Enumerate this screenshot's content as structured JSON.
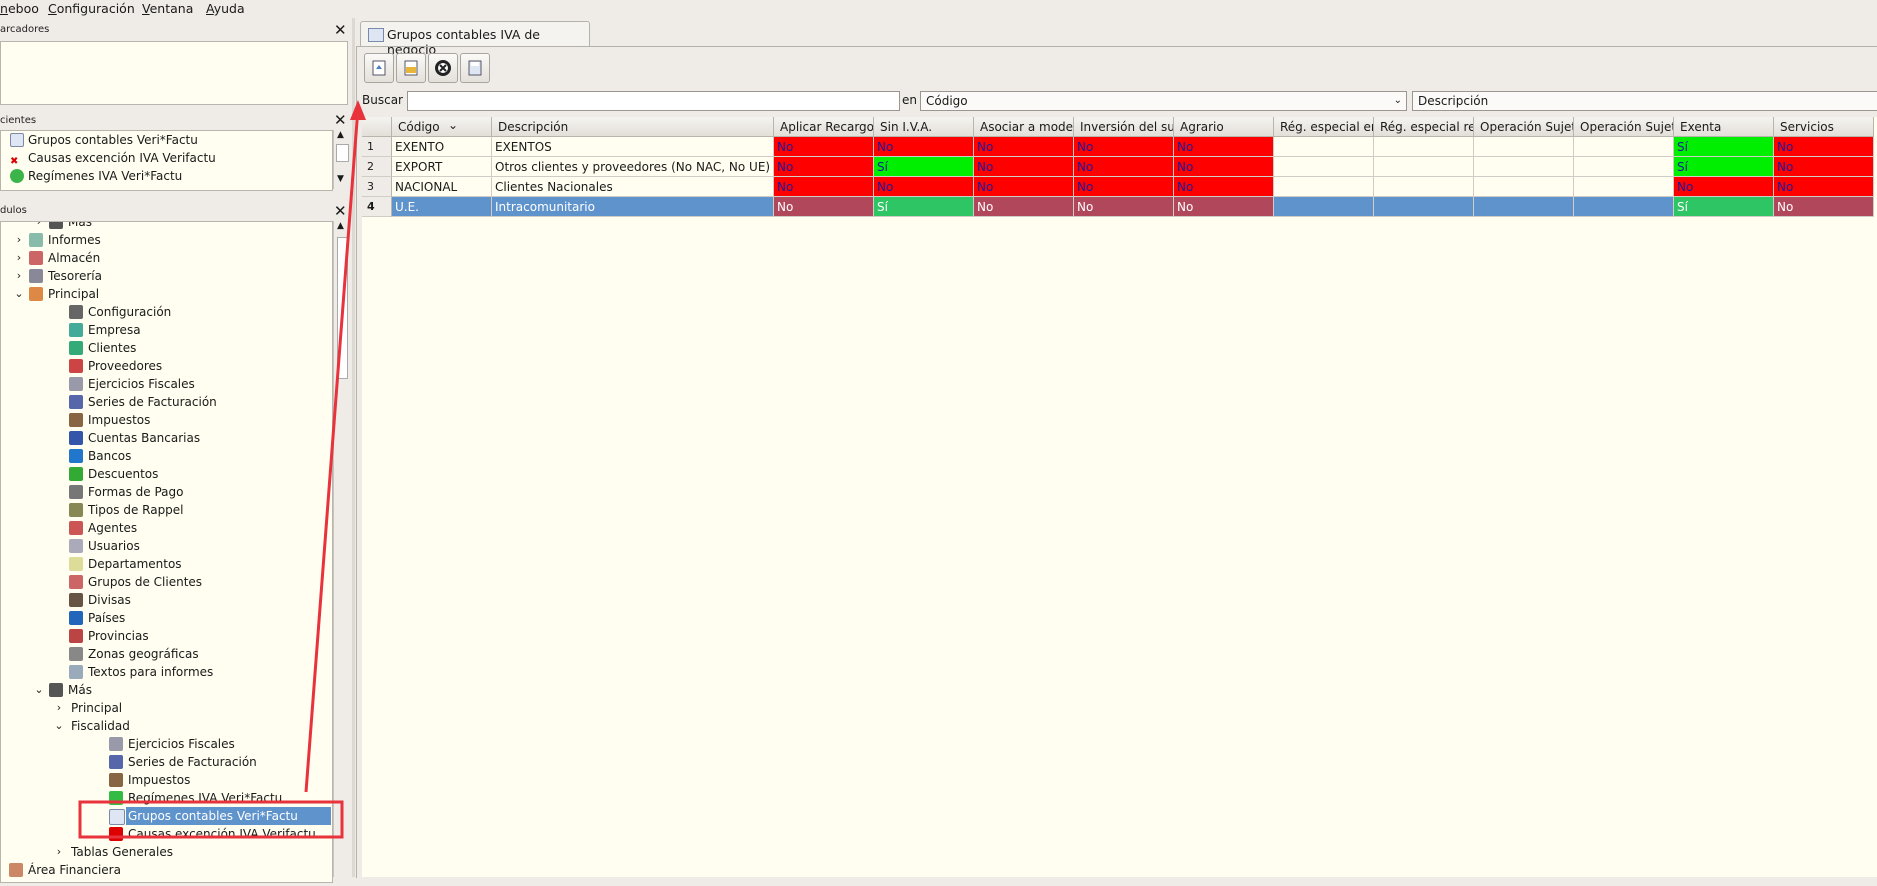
{
  "menu": [
    "neboo",
    "Configuración",
    "Ventana",
    "Ayuda"
  ],
  "panels": {
    "marcadores": "arcadores",
    "recientes": "cientes",
    "modulos": "dulos"
  },
  "recent": [
    "Grupos contables Veri*Factu",
    "Causas excención IVA Verifactu",
    "Regímenes IVA Veri*Factu"
  ],
  "tree": [
    {
      "label": "Más",
      "indent": 2,
      "expander": "›",
      "icon": "plus-icon"
    },
    {
      "label": "Informes",
      "indent": 1,
      "expander": "›",
      "icon": "reports-icon"
    },
    {
      "label": "Almacén",
      "indent": 1,
      "expander": "›",
      "icon": "warehouse-icon"
    },
    {
      "label": "Tesorería",
      "indent": 1,
      "expander": "›",
      "icon": "treasury-icon"
    },
    {
      "label": "Principal",
      "indent": 1,
      "expander": "⌄",
      "icon": "main-icon"
    },
    {
      "label": "Configuración",
      "indent": 3,
      "icon": "wrench-icon"
    },
    {
      "label": "Empresa",
      "indent": 3,
      "icon": "company-icon"
    },
    {
      "label": "Clientes",
      "indent": 3,
      "icon": "clients-icon"
    },
    {
      "label": "Proveedores",
      "indent": 3,
      "icon": "suppliers-icon"
    },
    {
      "label": "Ejercicios Fiscales",
      "indent": 3,
      "icon": "calendar-icon"
    },
    {
      "label": "Series de Facturación",
      "indent": 3,
      "icon": "series-icon"
    },
    {
      "label": "Impuestos",
      "indent": 3,
      "icon": "taxes-icon"
    },
    {
      "label": "Cuentas Bancarias",
      "indent": 3,
      "icon": "bank-account-icon"
    },
    {
      "label": "Bancos",
      "indent": 3,
      "icon": "bank-icon"
    },
    {
      "label": "Descuentos",
      "indent": 3,
      "icon": "discount-icon"
    },
    {
      "label": "Formas de Pago",
      "indent": 3,
      "icon": "payment-icon"
    },
    {
      "label": "Tipos de Rappel",
      "indent": 3,
      "icon": "rappel-icon"
    },
    {
      "label": "Agentes",
      "indent": 3,
      "icon": "agents-icon"
    },
    {
      "label": "Usuarios",
      "indent": 3,
      "icon": "users-icon"
    },
    {
      "label": "Departamentos",
      "indent": 3,
      "icon": "departments-icon"
    },
    {
      "label": "Grupos de Clientes",
      "indent": 3,
      "icon": "client-groups-icon"
    },
    {
      "label": "Divisas",
      "indent": 3,
      "icon": "currency-icon"
    },
    {
      "label": "Países",
      "indent": 3,
      "icon": "globe-icon"
    },
    {
      "label": "Provincias",
      "indent": 3,
      "icon": "provinces-icon"
    },
    {
      "label": "Zonas geográficas",
      "indent": 3,
      "icon": "zones-icon"
    },
    {
      "label": "Textos para informes",
      "indent": 3,
      "icon": "texts-icon"
    },
    {
      "label": "Más",
      "indent": 2,
      "expander": "⌄",
      "icon": "plus-icon"
    },
    {
      "label": "Principal",
      "indent": 3,
      "expander": "›"
    },
    {
      "label": "Fiscalidad",
      "indent": 3,
      "expander": "⌄"
    },
    {
      "label": "Ejercicios Fiscales",
      "indent": 5,
      "icon": "calendar-icon"
    },
    {
      "label": "Series de Facturación",
      "indent": 5,
      "icon": "series-icon"
    },
    {
      "label": "Impuestos",
      "indent": 5,
      "icon": "taxes-icon"
    },
    {
      "label": "Regímenes IVA Veri*Factu",
      "indent": 5,
      "icon": "regimes-icon"
    },
    {
      "label": "Grupos contables Veri*Factu",
      "indent": 5,
      "icon": "table-icon",
      "selected": true
    },
    {
      "label": "Causas excención IVA Verifactu",
      "indent": 5,
      "icon": "exemption-icon"
    },
    {
      "label": "Tablas Generales",
      "indent": 3,
      "expander": "›"
    },
    {
      "label": "Área Financiera",
      "indent": 0,
      "expander": "›",
      "icon": "finance-icon"
    }
  ],
  "tab_title": "Grupos contables IVA de negocio",
  "search": {
    "label": "Buscar",
    "value": "",
    "en_label": "en",
    "field": "Código",
    "order": "Descripción"
  },
  "columns": [
    "Código",
    "Descripción",
    "Aplicar Recargo",
    "Sin I.V.A.",
    "Asociar a model",
    "Inversión del su",
    "Agrario",
    "Rég. especial er",
    "Rég. especial re",
    "Operación Sujet",
    "Operación Sujet",
    "Exenta",
    "Servicios"
  ],
  "rows": [
    {
      "num": "1",
      "cells": [
        "EXENTO",
        "EXENTOS",
        "No",
        "No",
        "No",
        "No",
        "No",
        "",
        "",
        "",
        "",
        "Sí",
        "No"
      ]
    },
    {
      "num": "2",
      "cells": [
        "EXPORT",
        "Otros clientes y proveedores (No NAC, No UE)",
        "No",
        "Sí",
        "No",
        "No",
        "No",
        "",
        "",
        "",
        "",
        "Sí",
        "No"
      ]
    },
    {
      "num": "3",
      "cells": [
        "NACIONAL",
        "Clientes Nacionales",
        "No",
        "No",
        "No",
        "No",
        "No",
        "",
        "",
        "",
        "",
        "No",
        "No"
      ]
    },
    {
      "num": "4",
      "cells": [
        "U.E.",
        "Intracomunitario",
        "No",
        "Sí",
        "No",
        "No",
        "No",
        "",
        "",
        "",
        "",
        "Sí",
        "No"
      ],
      "selected": true
    }
  ],
  "colors": {
    "red": "#ff0000",
    "green": "#00ee00",
    "selection": "#5e93cc",
    "annotation": "#e8323c"
  }
}
